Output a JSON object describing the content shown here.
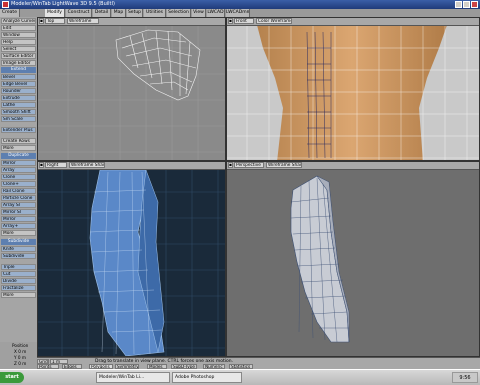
{
  "window": {
    "title": "Modeler/WinTab LightWave 3D 9.5 (BuiltI)"
  },
  "tabs": [
    {
      "label": "Create"
    },
    {
      "label": "Modify"
    },
    {
      "label": "Construct"
    },
    {
      "label": "Detail"
    },
    {
      "label": "Map"
    },
    {
      "label": "Setup"
    },
    {
      "label": "Utilities"
    },
    {
      "label": "Selection"
    },
    {
      "label": "View"
    },
    {
      "label": "LWCAD"
    },
    {
      "label": "LWCADmm"
    }
  ],
  "toolbox": {
    "items_top": [
      "Analyze Curves",
      "Edit",
      "Window",
      "Help",
      "Select",
      "Surface Editor",
      "Image Editor"
    ],
    "section_extend": "Extend",
    "items_extend": [
      "Bevel",
      "Edge Bevel",
      "Rounder",
      "Extrude",
      "Lathe",
      "Smooth Shift",
      "Sm Scale",
      "Extender Plus",
      "Create Rows",
      "More"
    ],
    "section_duplicate": "Duplicate",
    "items_duplicate": [
      "Mirror",
      "Array",
      "Clone",
      "Clone+",
      "Rail Clone",
      "Particle Clone",
      "Array Sl",
      "Mirror Sl",
      "Mirror",
      "Array+",
      "More"
    ],
    "section_subdivide": "Subdivide",
    "items_subdivide": [
      "Knife",
      "Subdivide",
      "Triple",
      "Cut",
      "Divide",
      "Fractalize",
      "More"
    ],
    "position_label": "Position",
    "position_values": [
      "X 0 m",
      "Y 0 m",
      "Z 0 m"
    ]
  },
  "viewports": {
    "top": {
      "view": "Top",
      "mode": "Wireframe"
    },
    "front": {
      "view": "Front",
      "mode": "Color Wireframe"
    },
    "right": {
      "view": "Right",
      "mode": "Wireframe Shade"
    },
    "perspective": {
      "view": "Perspective",
      "mode": "Wireframe Shade"
    }
  },
  "statusbar": {
    "grid_label": "Grid",
    "grid_value": "1 m",
    "points": "Points",
    "edges": "Edges",
    "polygons": "Polygons",
    "symmetry": "Symmetry",
    "modes": "Modes",
    "subd_type": "SubD-Type",
    "numeric": "Numeric",
    "statistics": "Statistics",
    "message": "Drag to translate in view plane. CTRL forces one axis motion."
  },
  "taskbar": {
    "start": "start",
    "tasks": [
      "Modeler/WinTab Li...",
      "Adobe Photoshop"
    ],
    "clock": "9:56"
  },
  "colors": {
    "right_viewport_bg": "#1a2a3a",
    "mesh_blue": "#5a88c8",
    "perspective_mesh": "#c8ccd4"
  }
}
